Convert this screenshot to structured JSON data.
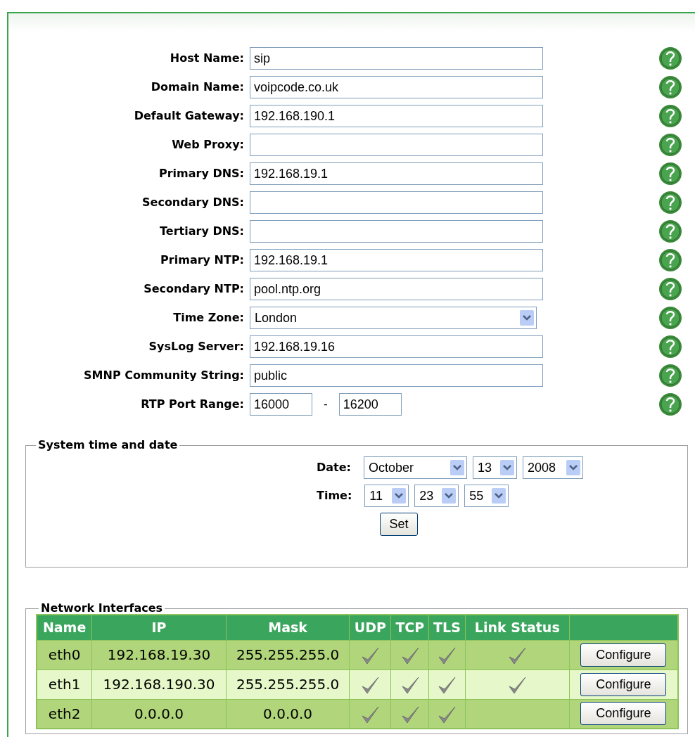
{
  "settings": [
    {
      "label": "Host Name:",
      "kind": "text",
      "value": "sip"
    },
    {
      "label": "Domain Name:",
      "kind": "text",
      "value": "voipcode.co.uk"
    },
    {
      "label": "Default Gateway:",
      "kind": "text",
      "value": "192.168.190.1"
    },
    {
      "label": "Web Proxy:",
      "kind": "text"
    },
    {
      "label": "Primary DNS:",
      "kind": "text",
      "value": "192.168.19.1"
    },
    {
      "label": "Secondary DNS:",
      "kind": "text"
    },
    {
      "label": "Tertiary DNS:",
      "kind": "text"
    },
    {
      "label": "Primary NTP:",
      "kind": "text",
      "value": "192.168.19.1"
    },
    {
      "label": "Secondary NTP:",
      "kind": "text",
      "value": "pool.ntp.org"
    },
    {
      "label": "Time Zone:",
      "kind": "select",
      "value": "London"
    },
    {
      "label": "SysLog Server:",
      "kind": "text",
      "value": "192.168.19.16"
    },
    {
      "label": "SMNP Community String:",
      "kind": "text",
      "value": "public"
    },
    {
      "label": "RTP Port Range:",
      "kind": "range",
      "from": "16000",
      "separator": "-",
      "to": "16200"
    }
  ],
  "system_time": {
    "legend": "System time and date",
    "date": {
      "label": "Date:",
      "month": "October",
      "day": "13",
      "year": "2008"
    },
    "time": {
      "label": "Time:",
      "hour": "11",
      "minute": "23",
      "second": "55"
    },
    "button": "Set"
  },
  "network_interfaces": {
    "legend": "Network Interfaces",
    "columns": [
      "Name",
      "IP",
      "Mask",
      "UDP",
      "TCP",
      "TLS",
      "Link Status"
    ],
    "rows": [
      {
        "name": "eth0",
        "ip": "192.168.19.30",
        "mask": "255.255.255.0",
        "udp": true,
        "tcp": true,
        "tls": true,
        "link": true,
        "button": "Configure"
      },
      {
        "name": "eth1",
        "ip": "192.168.190.30",
        "mask": "255.255.255.0",
        "udp": true,
        "tcp": true,
        "tls": true,
        "link": true,
        "button": "Configure"
      },
      {
        "name": "eth2",
        "ip": "0.0.0.0",
        "mask": "0.0.0.0",
        "udp": true,
        "tcp": true,
        "tls": true,
        "link": false,
        "button": "Configure"
      }
    ]
  }
}
